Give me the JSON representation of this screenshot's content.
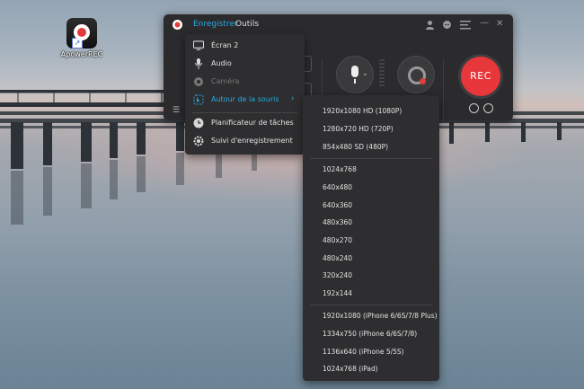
{
  "desktop": {
    "icon_label": "ApowerREC",
    "icon_name": "apowerrec-app-icon",
    "shortcut_glyph": "↗"
  },
  "app": {
    "menu": {
      "record": "Enregistrer",
      "tools": "Outils"
    },
    "title_icons": [
      "user-icon",
      "chat-icon",
      "settings-list-icon",
      "minimize-icon",
      "close-icon"
    ],
    "title_glyphs": {
      "minimize": "—",
      "close": "✕"
    },
    "rec_label": "REC",
    "list_glyph": "☰",
    "mic_chevron": "⌄",
    "accent_color": "#27a9e1",
    "rec_color": "#e7373b"
  },
  "dropdown": {
    "items": [
      {
        "label": "Écran 2",
        "icon": "monitor-icon"
      },
      {
        "label": "Audio",
        "icon": "microphone-icon"
      },
      {
        "label": "Caméra",
        "icon": "camera-icon",
        "disabled": true
      },
      {
        "label": "Autour de la souris",
        "icon": "mouse-area-icon",
        "active": true,
        "arrow": "›"
      },
      {
        "label": "Planificateur de tâches",
        "icon": "clock-icon"
      },
      {
        "label": "Suivi d'enregistrement",
        "icon": "gear-icon"
      }
    ]
  },
  "submenu": {
    "group1": [
      "1920x1080 HD (1080P)",
      "1280x720 HD (720P)",
      "854x480 SD (480P)"
    ],
    "group2": [
      "1024x768",
      "640x480",
      "640x360",
      "480x360",
      "480x270",
      "480x240",
      "320x240",
      "192x144"
    ],
    "group3": [
      "1920x1080 (iPhone 6/6S/7/8 Plus)",
      "1334x750 (iPhone 6/6S/7/8)",
      "1136x640 (iPhone 5/5S)",
      "1024x768 (iPad)"
    ]
  }
}
